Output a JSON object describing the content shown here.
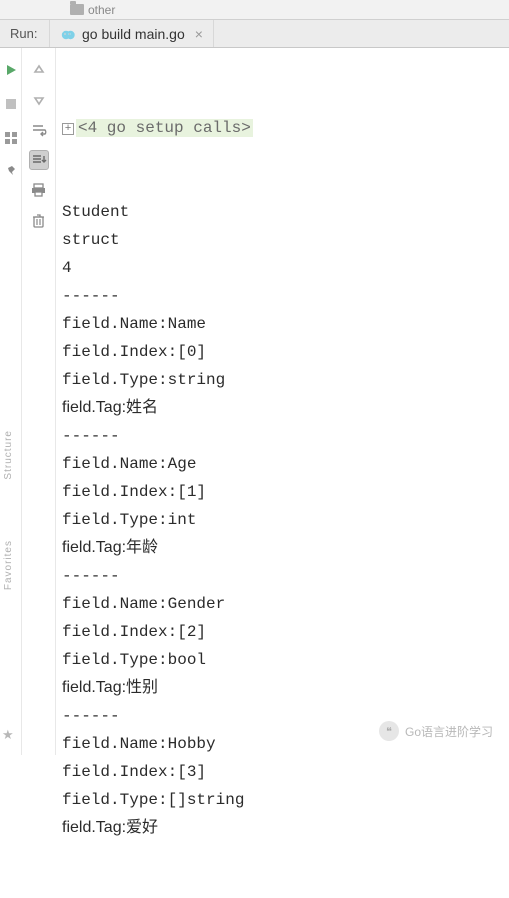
{
  "top_folder_label": "other",
  "run_panel_label": "Run:",
  "run_tab_label": "go build main.go",
  "fold_symbol": "+",
  "setup_line": "<4 go setup calls>",
  "console_lines": [
    "Student",
    "struct",
    "4",
    "------",
    "field.Name:Name",
    "field.Index:[0]",
    "field.Type:string",
    "field.Tag:姓名",
    "------",
    "field.Name:Age",
    "field.Index:[1]",
    "field.Type:int",
    "field.Tag:年龄",
    "------",
    "field.Name:Gender",
    "field.Index:[2]",
    "field.Type:bool",
    "field.Tag:性别",
    "------",
    "field.Name:Hobby",
    "field.Index:[3]",
    "field.Type:[]string",
    "field.Tag:爱好"
  ],
  "watermark_text": "Go语言进阶学习",
  "left_rail": {
    "structure": "Structure",
    "favorites": "Favorites"
  }
}
